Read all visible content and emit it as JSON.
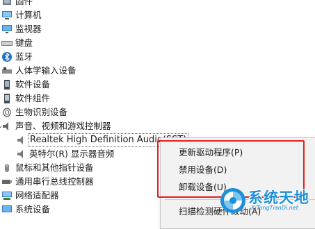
{
  "tree": {
    "categories": [
      {
        "label": "固件",
        "icon": "firmware-icon"
      },
      {
        "label": "计算机",
        "icon": "computer-icon"
      },
      {
        "label": "监视器",
        "icon": "monitor-icon"
      },
      {
        "label": "键盘",
        "icon": "keyboard-icon"
      },
      {
        "label": "蓝牙",
        "icon": "bluetooth-icon"
      },
      {
        "label": "人体学输入设备",
        "icon": "hid-icon"
      },
      {
        "label": "软件设备",
        "icon": "software-device-icon"
      },
      {
        "label": "软件组件",
        "icon": "software-component-icon"
      },
      {
        "label": "生物识别设备",
        "icon": "biometric-icon"
      },
      {
        "label": "声音、视频和游戏控制器",
        "icon": "speaker-icon"
      }
    ],
    "audio_children": [
      {
        "label": "Realtek High Definition Audio(SST)",
        "icon": "audio-device-icon"
      },
      {
        "label": "英特尔(R) 显示器音频",
        "icon": "audio-device-icon"
      }
    ],
    "more_categories": [
      {
        "label": "鼠标和其他指针设备",
        "icon": "mouse-icon"
      },
      {
        "label": "通用串行总线控制器",
        "icon": "usb-icon"
      },
      {
        "label": "网络适配器",
        "icon": "network-adapter-icon"
      },
      {
        "label": "系统设备",
        "icon": "system-device-icon"
      }
    ]
  },
  "context_menu": {
    "items": [
      "更新驱动程序(P)",
      "禁用设备(D)",
      "卸载设备(U)",
      "扫描检测硬件改动(A)"
    ]
  },
  "watermark": {
    "brand": "系统天地",
    "site": "XiTongTianDi.net"
  },
  "colors": {
    "highlight": "#e0211d",
    "watermark": "#1c8fd8"
  }
}
